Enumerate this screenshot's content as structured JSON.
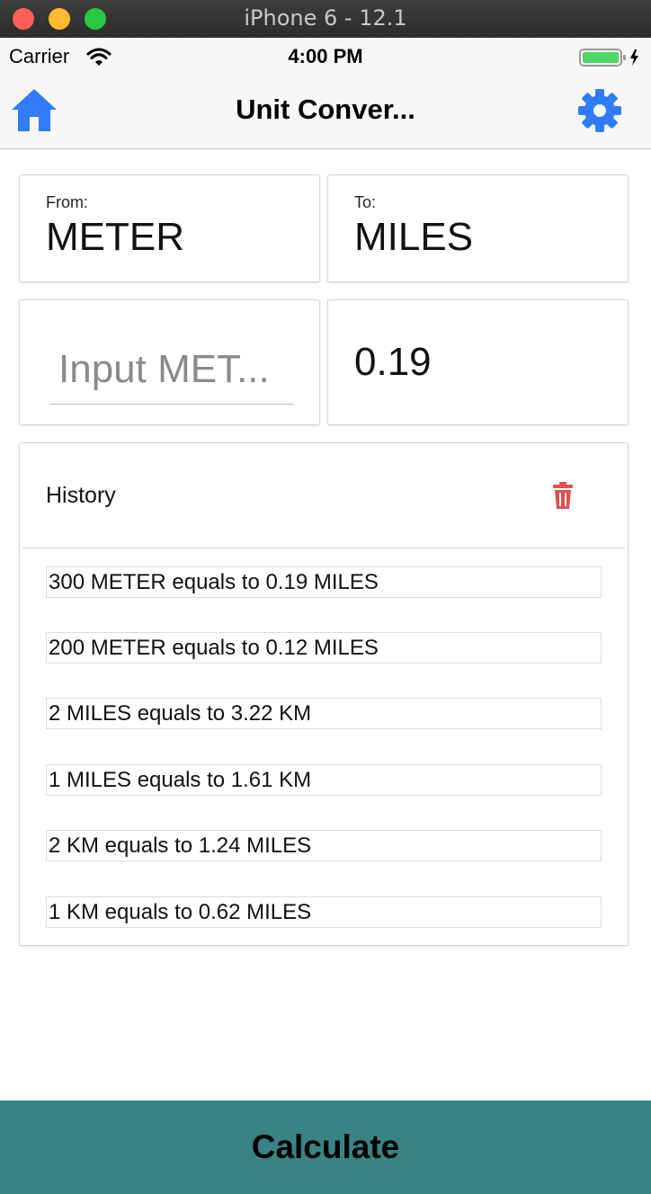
{
  "window": {
    "title": "iPhone 6 - 12.1"
  },
  "status_bar": {
    "carrier": "Carrier",
    "time": "4:00 PM"
  },
  "nav": {
    "title": "Unit Conver..."
  },
  "from": {
    "label": "From:",
    "unit": "METER"
  },
  "to": {
    "label": "To:",
    "unit": "MILES"
  },
  "input": {
    "placeholder": "Input MET...",
    "value": ""
  },
  "result": {
    "value": "0.19"
  },
  "history": {
    "title": "History",
    "items": [
      "300 METER equals to 0.19 MILES",
      "200 METER equals to 0.12 MILES",
      "2 MILES equals to 3.22 KM",
      "1 MILES equals to 1.61 KM",
      "2 KM equals to 1.24 MILES",
      "1 KM equals to 0.62 MILES"
    ]
  },
  "action": {
    "calculate_label": "Calculate"
  },
  "colors": {
    "accent_blue": "#2f7cf6",
    "calculate_bg": "#3a8383",
    "trash_red": "#d9534f",
    "battery_green": "#4cd964"
  },
  "icons": [
    "wifi-icon",
    "battery-icon",
    "home-icon",
    "gear-icon",
    "trash-icon"
  ]
}
